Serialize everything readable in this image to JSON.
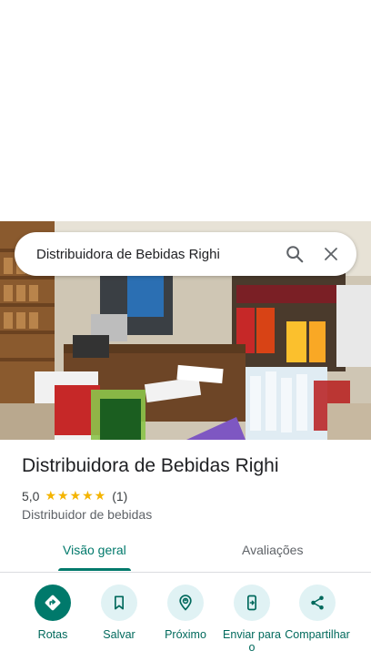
{
  "search": {
    "query": "Distribuidora de Bebidas Righi"
  },
  "place": {
    "name": "Distribuidora de Bebidas Righi",
    "rating": "5,0",
    "stars": "★★★★★",
    "review_count": "(1)",
    "category": "Distribuidor de bebidas"
  },
  "tabs": [
    {
      "label": "Visão geral",
      "active": true
    },
    {
      "label": "Avaliações",
      "active": false
    }
  ],
  "actions": [
    {
      "label": "Rotas",
      "icon": "directions-icon"
    },
    {
      "label": "Salvar",
      "icon": "bookmark-icon"
    },
    {
      "label": "Próximo",
      "icon": "nearby-icon"
    },
    {
      "label": "Enviar para o",
      "icon": "send-to-phone-icon"
    },
    {
      "label": "Compartilhar",
      "icon": "share-icon"
    }
  ],
  "colors": {
    "accent": "#00796b",
    "action_bg": "#e0f2f4",
    "star": "#f4b400"
  }
}
